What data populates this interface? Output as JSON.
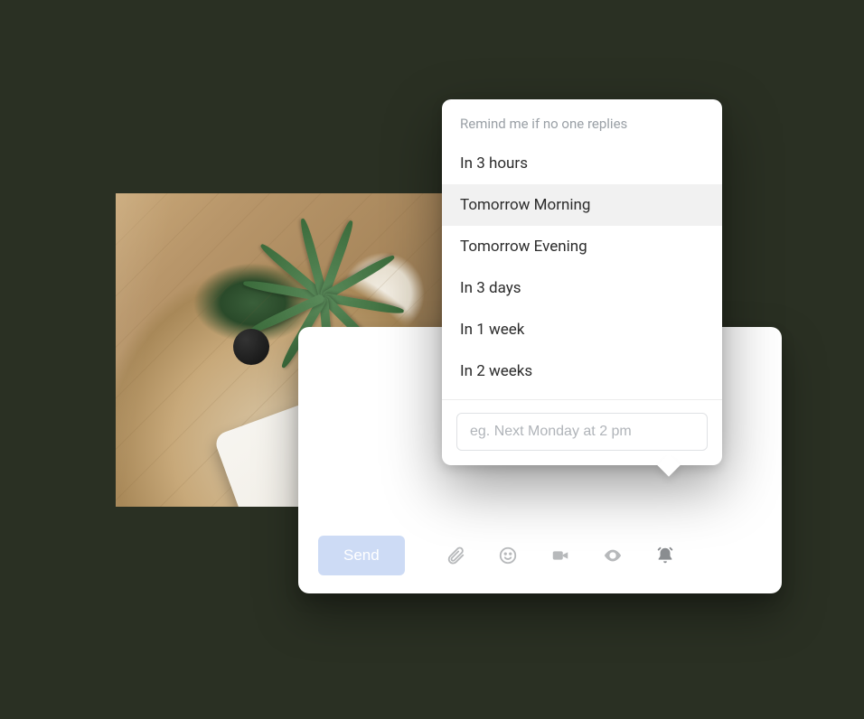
{
  "reminder": {
    "title": "Remind me if no one replies",
    "options": [
      "In 3 hours",
      "Tomorrow Morning",
      "Tomorrow Evening",
      "In 3 days",
      "In 1 week",
      "In 2 weeks"
    ],
    "highlighted_index": 1,
    "custom_placeholder": "eg. Next Monday at 2 pm"
  },
  "compose": {
    "send_label": "Send"
  },
  "icons": {
    "attach": "attachment-icon",
    "emoji": "emoji-icon",
    "video": "video-icon",
    "watch": "eye-icon",
    "remind": "bell-icon"
  }
}
